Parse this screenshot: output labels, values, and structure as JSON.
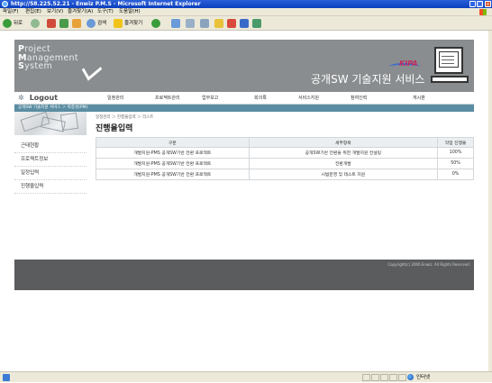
{
  "window": {
    "title": "http://58.225.52.21 - Enwiz P.M.S - Microsoft Internet Explorer",
    "min": "_",
    "max": "□",
    "close": "x"
  },
  "menubar": [
    "파일(F)",
    "편집(E)",
    "보기(V)",
    "즐겨찾기(A)",
    "도구(T)",
    "도움말(H)"
  ],
  "toolbar": {
    "back": "뒤로",
    "search": "검색",
    "favorites": "즐겨찾기"
  },
  "header": {
    "logo_lines": [
      "roject",
      "anagement",
      "ystem"
    ],
    "logo_caps": [
      "P",
      "M",
      "S"
    ],
    "service_title": "공개SW 기술지원 서비스",
    "kipa": "KIPA"
  },
  "nav": {
    "logout": "Logout",
    "items": [
      "일정관리",
      "프로젝트관리",
      "업무보고",
      "회의록",
      "서비스지원",
      "참여인력",
      "게시판"
    ]
  },
  "strip": {
    "text": "공개SW 기술지원 서비스 ＞ 박종성(PM)"
  },
  "sidebar": {
    "items": [
      "근태현황",
      "프로젝트정보",
      "일정입력",
      "진행율입력"
    ]
  },
  "main": {
    "breadcrumb": "일정관리 ＞ 진행율입력 ＞ 리스트",
    "title": "진행율입력",
    "columns": [
      "구분",
      "세부항목",
      "작업 진행율"
    ],
    "rows": [
      [
        "개발지원-PMS 공개SW기반 전환 프로젝트",
        "공개SW기반 전환을 위한 개발지원 컨설팅",
        "100%"
      ],
      [
        "개발지원-PMS 공개SW기반 전환 프로젝트",
        "전환개발",
        "50%"
      ],
      [
        "개발지원-PMS 공개SW기반 전환 프로젝트",
        "시범운영 및 테스트 지원",
        "0%"
      ]
    ]
  },
  "footer": {
    "copyright": "Copyright(c) 2006 Enwiz. All Rights Reserved."
  },
  "statusbar": {
    "zone": "인터넷"
  }
}
